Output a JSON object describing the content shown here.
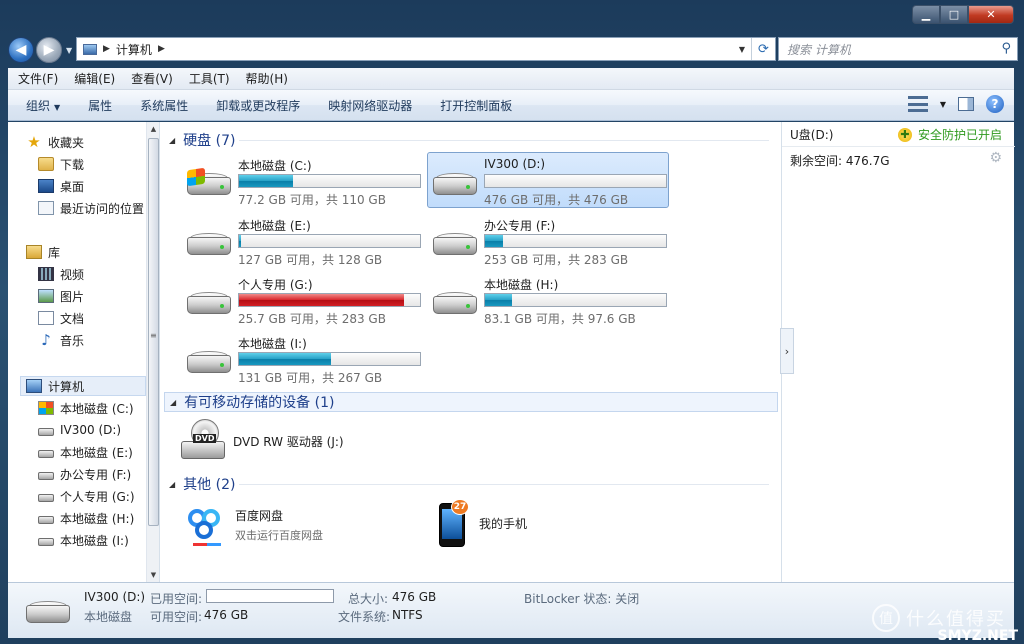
{
  "window": {
    "minimize": "▁",
    "maximize": "□",
    "close": "✕"
  },
  "address": {
    "crumbs": [
      "计算机"
    ],
    "search_placeholder": "搜索 计算机"
  },
  "menu": [
    "文件(F)",
    "编辑(E)",
    "查看(V)",
    "工具(T)",
    "帮助(H)"
  ],
  "commands": [
    "组织",
    "属性",
    "系统属性",
    "卸载或更改程序",
    "映射网络驱动器",
    "打开控制面板"
  ],
  "nav": {
    "favorites": "收藏夹",
    "fav_items": [
      "下载",
      "桌面",
      "最近访问的位置"
    ],
    "libraries": "库",
    "lib_items": [
      "视频",
      "图片",
      "文档",
      "音乐"
    ],
    "computer": "计算机",
    "drives": [
      "本地磁盘 (C:)",
      "IV300 (D:)",
      "本地磁盘 (E:)",
      "办公专用 (F:)",
      "个人专用 (G:)",
      "本地磁盘 (H:)",
      "本地磁盘 (I:)"
    ]
  },
  "sections": {
    "hdd": "硬盘 (7)",
    "removable": "有可移动存储的设备 (1)",
    "other": "其他 (2)"
  },
  "drives": [
    {
      "name": "本地磁盘 (C:)",
      "info": "77.2 GB 可用，共 110 GB",
      "used_fraction": 0.3,
      "color": "#1898c0"
    },
    {
      "name": "IV300 (D:)",
      "info": "476 GB 可用，共 476 GB",
      "used_fraction": 0.0,
      "color": "#1898c0"
    },
    {
      "name": "本地磁盘 (E:)",
      "info": "127 GB 可用，共 128 GB",
      "used_fraction": 0.01,
      "color": "#1898c0"
    },
    {
      "name": "办公专用 (F:)",
      "info": "253 GB 可用，共 283 GB",
      "used_fraction": 0.1,
      "color": "#1898c0"
    },
    {
      "name": "个人专用 (G:)",
      "info": "25.7 GB 可用，共 283 GB",
      "used_fraction": 0.91,
      "color": "#d22026"
    },
    {
      "name": "本地磁盘 (H:)",
      "info": "83.1 GB 可用，共 97.6 GB",
      "used_fraction": 0.15,
      "color": "#1898c0"
    },
    {
      "name": "本地磁盘 (I:)",
      "info": "131 GB 可用，共 267 GB",
      "used_fraction": 0.51,
      "color": "#1898c0"
    }
  ],
  "devices": {
    "dvd": "DVD RW 驱动器 (J:)",
    "dvd_label": "DVD"
  },
  "other": {
    "baidu_title": "百度网盘",
    "baidu_sub": "双击运行百度网盘",
    "phone_title": "我的手机",
    "phone_badge": "27"
  },
  "right_panel": {
    "drive": "U盘(D:)",
    "safe": "安全防护已开启",
    "free": "剩余空间: 476.7G"
  },
  "details": {
    "name": "IV300 (D:)",
    "type": "本地磁盘",
    "used_label": "已用空间:",
    "free_label": "可用空间:",
    "free_value": "476 GB",
    "total_label": "总大小:",
    "total_value": "476 GB",
    "fs_label": "文件系统:",
    "fs_value": "NTFS",
    "bitlocker": "BitLocker 状态: 关闭"
  },
  "watermark": {
    "text": "什么值得买",
    "site": "SMYZ.NET",
    "logo": "值"
  }
}
